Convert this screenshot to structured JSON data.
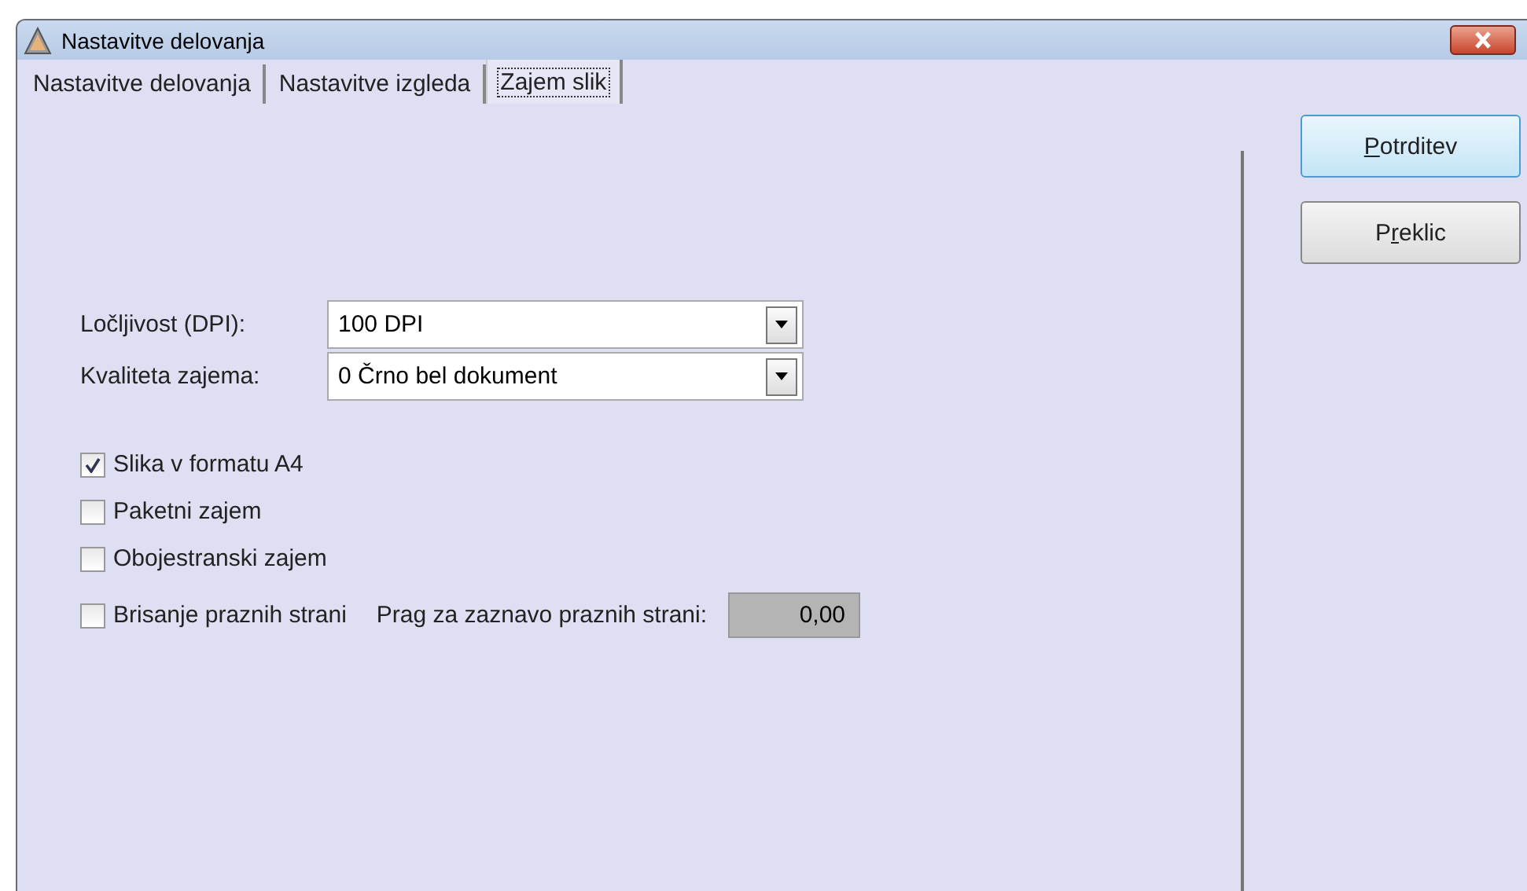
{
  "window": {
    "title": "Nastavitve delovanja"
  },
  "tabs": [
    {
      "label": "Nastavitve delovanja",
      "selected": false
    },
    {
      "label": "Nastavitve izgleda",
      "selected": false
    },
    {
      "label": "Zajem slik",
      "selected": true
    }
  ],
  "dropdowns": [
    {
      "label": "Ločljivost (DPI):",
      "value": "100 DPI"
    },
    {
      "label": "Kvaliteta zajema:",
      "value": "0 Črno bel dokument"
    }
  ],
  "checkboxes": [
    {
      "label": "Slika v formatu A4",
      "checked": true
    },
    {
      "label": "Paketni zajem",
      "checked": false
    },
    {
      "label": "Obojestranski zajem",
      "checked": false
    },
    {
      "label": "Brisanje praznih strani",
      "checked": false,
      "threshold": {
        "label": "Prag za zaznavo praznih strani:",
        "value": "0,00",
        "disabled": true
      }
    }
  ],
  "buttons": [
    {
      "key": "P",
      "after": "otrditev",
      "default": true
    },
    {
      "before": "P",
      "key": "r",
      "after": "eklic",
      "default": false
    }
  ]
}
